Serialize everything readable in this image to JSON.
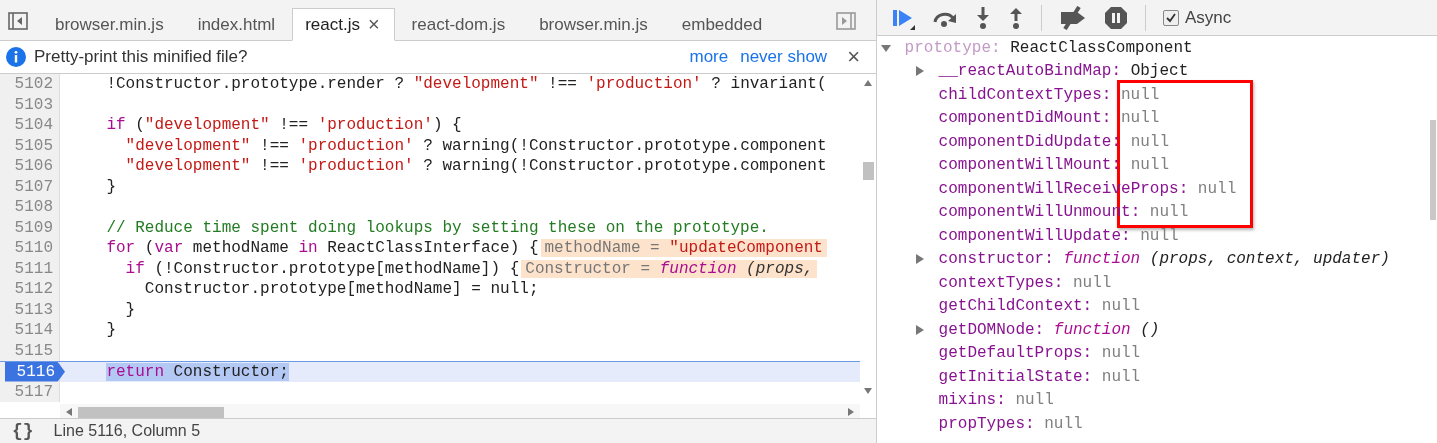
{
  "editor": {
    "tabs": [
      {
        "label": "browser.min.js",
        "selected": false
      },
      {
        "label": "index.html",
        "selected": false
      },
      {
        "label": "react.js",
        "selected": true,
        "close": "×"
      },
      {
        "label": "react-dom.js",
        "selected": false
      },
      {
        "label": "browser.min.js",
        "selected": false
      },
      {
        "label": "embedded",
        "selected": false
      }
    ],
    "infobar": {
      "message": "Pretty-print this minified file?",
      "links": [
        "more",
        "never show"
      ],
      "close": "×"
    },
    "lines": [
      {
        "number": "5102",
        "selected": false,
        "segments": [
          {
            "kind": "plain",
            "text": "    !Constructor.prototype.render ? "
          },
          {
            "kind": "string",
            "text": "\"development\""
          },
          {
            "kind": "plain",
            "text": " !== "
          },
          {
            "kind": "string",
            "text": "'production'"
          },
          {
            "kind": "plain",
            "text": " ? invariant("
          }
        ]
      },
      {
        "number": "5103",
        "selected": false
      },
      {
        "number": "5104",
        "selected": false,
        "segments": [
          {
            "kind": "keyword",
            "text": "    if"
          },
          {
            "kind": "plain",
            "text": " ("
          },
          {
            "kind": "string",
            "text": "\"development\""
          },
          {
            "kind": "plain",
            "text": " !== "
          },
          {
            "kind": "string",
            "text": "'production'"
          },
          {
            "kind": "plain",
            "text": ") {"
          }
        ]
      },
      {
        "number": "5105",
        "selected": false,
        "segments": [
          {
            "kind": "string",
            "text": "      \"development\""
          },
          {
            "kind": "plain",
            "text": " !== "
          },
          {
            "kind": "string",
            "text": "'production'"
          },
          {
            "kind": "plain",
            "text": " ? warning(!Constructor.prototype.component"
          }
        ]
      },
      {
        "number": "5106",
        "selected": false,
        "segments": [
          {
            "kind": "string",
            "text": "      \"development\""
          },
          {
            "kind": "plain",
            "text": " !== "
          },
          {
            "kind": "string",
            "text": "'production'"
          },
          {
            "kind": "plain",
            "text": " ? warning(!Constructor.prototype.component"
          }
        ]
      },
      {
        "number": "5107",
        "selected": false,
        "segments": [
          {
            "kind": "plain",
            "text": "    }"
          }
        ]
      },
      {
        "number": "5108",
        "selected": false
      },
      {
        "number": "5109",
        "selected": false,
        "segments": [
          {
            "kind": "comment",
            "text": "    // Reduce time spent doing lookups by setting these on the prototype."
          }
        ]
      },
      {
        "number": "5110",
        "selected": false,
        "segments": [
          {
            "kind": "keyword",
            "text": "    for"
          },
          {
            "kind": "plain",
            "text": " ("
          },
          {
            "kind": "keyword",
            "text": "var"
          },
          {
            "kind": "plain",
            "text": " methodName "
          },
          {
            "kind": "keyword",
            "text": "in"
          },
          {
            "kind": "plain",
            "text": " ReactClassInterface) {"
          }
        ],
        "inline_value": [
          {
            "kind": "name",
            "text": "methodName = "
          },
          {
            "kind": "string",
            "text": "\"updateComponent"
          }
        ]
      },
      {
        "number": "5111",
        "selected": false,
        "segments": [
          {
            "kind": "keyword",
            "text": "      if"
          },
          {
            "kind": "plain",
            "text": " (!Constructor.prototype[methodName]) {"
          }
        ],
        "inline_value": [
          {
            "kind": "name",
            "text": "Constructor = "
          },
          {
            "kind": "italic-keyword",
            "text": "function"
          },
          {
            "kind": "italic",
            "text": " (props,"
          }
        ]
      },
      {
        "number": "5112",
        "selected": false,
        "segments": [
          {
            "kind": "plain",
            "text": "        Constructor.prototype[methodName] = null;"
          }
        ]
      },
      {
        "number": "5113",
        "selected": false,
        "segments": [
          {
            "kind": "plain",
            "text": "      }"
          }
        ]
      },
      {
        "number": "5114",
        "selected": false,
        "segments": [
          {
            "kind": "plain",
            "text": "    }"
          }
        ]
      },
      {
        "number": "5115",
        "selected": false
      },
      {
        "number": "5116",
        "selected": true,
        "segments": [
          {
            "kind": "keyword",
            "text": "    return"
          },
          {
            "kind": "plain",
            "text": " Constructor;"
          }
        ]
      },
      {
        "number": "5117",
        "selected": false
      }
    ],
    "status_bar": {
      "format_glyph": "{}",
      "position": "Line 5116, Column 5"
    }
  },
  "debugger": {
    "toolbar": {
      "async": {
        "label": "Async",
        "checked": true
      }
    },
    "scope": [
      {
        "name": "prototype:",
        "value": "ReactClassComponent",
        "kind": "object",
        "expanded": true,
        "children": [
          {
            "name": "__reactAutoBindMap:",
            "value": "Object",
            "kind": "object",
            "expanded": false
          },
          {
            "name": "childContextTypes:",
            "value": "null",
            "kind": "null"
          },
          {
            "name": "componentDidMount:",
            "value": "null",
            "kind": "null"
          },
          {
            "name": "componentDidUpdate:",
            "value": "null",
            "kind": "null"
          },
          {
            "name": "componentWillMount:",
            "value": "null",
            "kind": "null"
          },
          {
            "name": "componentWillReceiveProps:",
            "value": "null",
            "kind": "null"
          },
          {
            "name": "componentWillUnmount:",
            "value": "null",
            "kind": "null"
          },
          {
            "name": "componentWillUpdate:",
            "value": "null",
            "kind": "null"
          },
          {
            "name": "constructor:",
            "value": "function",
            "signature": "(props, context, updater)",
            "kind": "function",
            "expanded": false
          },
          {
            "name": "contextTypes:",
            "value": "null",
            "kind": "null"
          },
          {
            "name": "getChildContext:",
            "value": "null",
            "kind": "null"
          },
          {
            "name": "getDOMNode:",
            "value": "function",
            "signature": "()",
            "kind": "function",
            "expanded": false
          },
          {
            "name": "getDefaultProps:",
            "value": "null",
            "kind": "null"
          },
          {
            "name": "getInitialState:",
            "value": "null",
            "kind": "null"
          },
          {
            "name": "mixins:",
            "value": "null",
            "kind": "null"
          },
          {
            "name": "propTypes:",
            "value": "null",
            "kind": "null"
          }
        ]
      }
    ]
  }
}
